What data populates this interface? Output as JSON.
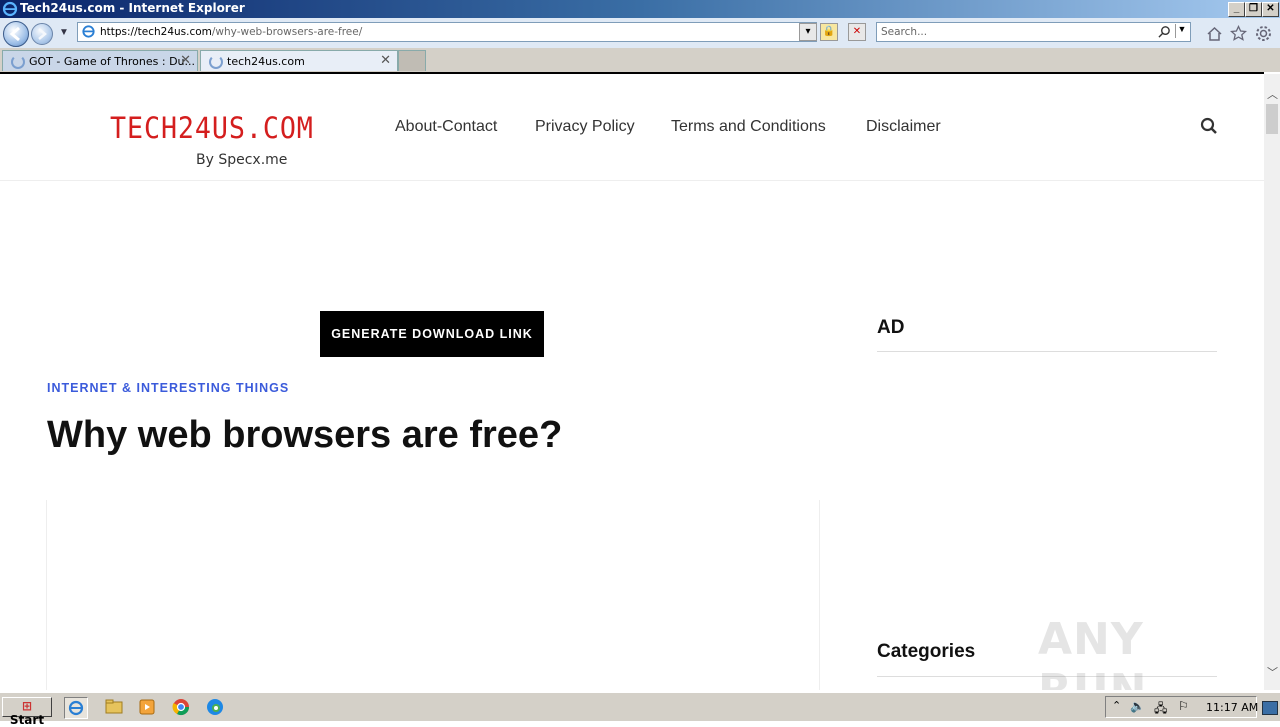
{
  "window": {
    "title": "Tech24us.com - Internet Explorer"
  },
  "navbar": {
    "url_host": "https://tech24us.com",
    "url_path": "/why-web-browsers-are-free/",
    "search_placeholder": "Search..."
  },
  "tabs": [
    {
      "label": "GOT - Game of Thrones : Du..."
    },
    {
      "label": "tech24us.com"
    }
  ],
  "site": {
    "logo_main": "TECH24US.COM",
    "logo_sub": "By Specx.me",
    "menu": [
      "About-Contact",
      "Privacy Policy",
      "Terms and Conditions",
      "Disclaimer"
    ]
  },
  "main": {
    "download_button": "GENERATE DOWNLOAD LINK",
    "category": "INTERNET & INTERESTING THINGS",
    "headline": "Why web browsers are free?"
  },
  "sidebar": {
    "ad_heading": "AD",
    "categories_heading": "Categories"
  },
  "watermark": "ANY RUN",
  "taskbar": {
    "start_label": "Start",
    "clock": "11:17 AM"
  }
}
